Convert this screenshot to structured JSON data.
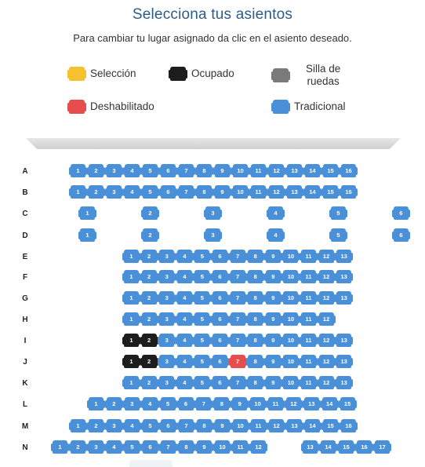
{
  "header": {
    "title": "Selecciona tus asientos",
    "subtitle": "Para cambiar tu lugar asignado da clic en el asiento deseado."
  },
  "legend": [
    {
      "key": "seleccion",
      "label": "Selección",
      "color": "#f5c12e"
    },
    {
      "key": "ocupado",
      "label": "Ocupado",
      "color": "#1d1d1d"
    },
    {
      "key": "silla",
      "label": "Silla de\nruedas",
      "color": "#7a7a7a"
    },
    {
      "key": "deshabilitado",
      "label": "Deshabilitado",
      "color": "#e84d4d"
    },
    {
      "key": "tradicional",
      "label": "Tradicional",
      "color": "#4a90d9"
    }
  ],
  "colors": {
    "tradicional": "#4a90d9",
    "ocupado": "#1d1d1d",
    "deshabilitado": "#e84d4d",
    "seleccion": "#f5c12e",
    "silla": "#7a7a7a"
  },
  "rows": [
    {
      "label": "A",
      "seats": [
        {
          "n": "1"
        },
        {
          "n": "2"
        },
        {
          "n": "3"
        },
        {
          "n": "4"
        },
        {
          "n": "5"
        },
        {
          "n": "6"
        },
        {
          "n": "7"
        },
        {
          "n": "8"
        },
        {
          "n": "9"
        },
        {
          "n": "10"
        },
        {
          "n": "11"
        },
        {
          "n": "12"
        },
        {
          "n": "13"
        },
        {
          "n": "14"
        },
        {
          "n": "15"
        },
        {
          "n": "16"
        }
      ]
    },
    {
      "label": "B",
      "seats": [
        {
          "n": "1"
        },
        {
          "n": "2"
        },
        {
          "n": "3"
        },
        {
          "n": "4"
        },
        {
          "n": "5"
        },
        {
          "n": "6"
        },
        {
          "n": "7"
        },
        {
          "n": "8"
        },
        {
          "n": "9"
        },
        {
          "n": "10"
        },
        {
          "n": "11"
        },
        {
          "n": "12"
        },
        {
          "n": "13"
        },
        {
          "n": "14"
        },
        {
          "n": "15"
        },
        {
          "n": "16"
        }
      ]
    },
    {
      "label": "C",
      "seats": [
        {
          "n": "1"
        },
        {
          "n": "2"
        },
        {
          "n": "3"
        },
        {
          "n": "4"
        },
        {
          "n": "5"
        },
        {
          "n": "6"
        }
      ]
    },
    {
      "label": "D",
      "seats": [
        {
          "n": "1"
        },
        {
          "n": "2"
        },
        {
          "n": "3"
        },
        {
          "n": "4"
        },
        {
          "n": "5"
        },
        {
          "n": "6"
        }
      ]
    },
    {
      "label": "E",
      "seats": [
        {
          "n": "1"
        },
        {
          "n": "2"
        },
        {
          "n": "3"
        },
        {
          "n": "4"
        },
        {
          "n": "5"
        },
        {
          "n": "6"
        },
        {
          "n": "7"
        },
        {
          "n": "8"
        },
        {
          "n": "9"
        },
        {
          "n": "10"
        },
        {
          "n": "11"
        },
        {
          "n": "12"
        },
        {
          "n": "13"
        }
      ]
    },
    {
      "label": "F",
      "seats": [
        {
          "n": "1"
        },
        {
          "n": "2"
        },
        {
          "n": "3"
        },
        {
          "n": "4"
        },
        {
          "n": "5"
        },
        {
          "n": "6"
        },
        {
          "n": "7"
        },
        {
          "n": "8"
        },
        {
          "n": "9"
        },
        {
          "n": "10"
        },
        {
          "n": "11"
        },
        {
          "n": "12"
        },
        {
          "n": "13"
        }
      ]
    },
    {
      "label": "G",
      "seats": [
        {
          "n": "1"
        },
        {
          "n": "2"
        },
        {
          "n": "3"
        },
        {
          "n": "4"
        },
        {
          "n": "5"
        },
        {
          "n": "6"
        },
        {
          "n": "7"
        },
        {
          "n": "8"
        },
        {
          "n": "9"
        },
        {
          "n": "10"
        },
        {
          "n": "11"
        },
        {
          "n": "12"
        },
        {
          "n": "13"
        }
      ]
    },
    {
      "label": "H",
      "seats": [
        {
          "n": "1"
        },
        {
          "n": "2"
        },
        {
          "n": "3"
        },
        {
          "n": "4"
        },
        {
          "n": "5"
        },
        {
          "n": "6"
        },
        {
          "n": "7"
        },
        {
          "n": "8"
        },
        {
          "n": "9"
        },
        {
          "n": "10"
        },
        {
          "n": "11"
        },
        {
          "n": "12"
        }
      ]
    },
    {
      "label": "I",
      "seats": [
        {
          "n": "1",
          "status": "ocupado"
        },
        {
          "n": "2",
          "status": "ocupado"
        },
        {
          "n": "3"
        },
        {
          "n": "4"
        },
        {
          "n": "5"
        },
        {
          "n": "6"
        },
        {
          "n": "7"
        },
        {
          "n": "8"
        },
        {
          "n": "9"
        },
        {
          "n": "10"
        },
        {
          "n": "11"
        },
        {
          "n": "12"
        },
        {
          "n": "13"
        }
      ]
    },
    {
      "label": "J",
      "seats": [
        {
          "n": "1",
          "status": "ocupado"
        },
        {
          "n": "2",
          "status": "ocupado"
        },
        {
          "n": "3"
        },
        {
          "n": "4"
        },
        {
          "n": "5"
        },
        {
          "n": "6"
        },
        {
          "n": "7",
          "status": "deshabilitado"
        },
        {
          "n": "8"
        },
        {
          "n": "9"
        },
        {
          "n": "10"
        },
        {
          "n": "11"
        },
        {
          "n": "12"
        },
        {
          "n": "13"
        }
      ]
    },
    {
      "label": "K",
      "seats": [
        {
          "n": "1"
        },
        {
          "n": "2"
        },
        {
          "n": "3"
        },
        {
          "n": "4"
        },
        {
          "n": "5"
        },
        {
          "n": "6"
        },
        {
          "n": "7"
        },
        {
          "n": "8"
        },
        {
          "n": "9"
        },
        {
          "n": "10"
        },
        {
          "n": "11"
        },
        {
          "n": "12"
        },
        {
          "n": "13"
        }
      ]
    },
    {
      "label": "L",
      "seats": [
        {
          "n": "1"
        },
        {
          "n": "2"
        },
        {
          "n": "3"
        },
        {
          "n": "4"
        },
        {
          "n": "5"
        },
        {
          "n": "6"
        },
        {
          "n": "7"
        },
        {
          "n": "8"
        },
        {
          "n": "9"
        },
        {
          "n": "10"
        },
        {
          "n": "11"
        },
        {
          "n": "12"
        },
        {
          "n": "13"
        },
        {
          "n": "14"
        },
        {
          "n": "15"
        }
      ]
    },
    {
      "label": "M",
      "seats": [
        {
          "n": "1"
        },
        {
          "n": "2"
        },
        {
          "n": "3"
        },
        {
          "n": "4"
        },
        {
          "n": "5"
        },
        {
          "n": "6"
        },
        {
          "n": "7"
        },
        {
          "n": "8"
        },
        {
          "n": "9"
        },
        {
          "n": "10"
        },
        {
          "n": "11"
        },
        {
          "n": "12"
        },
        {
          "n": "13"
        },
        {
          "n": "14"
        },
        {
          "n": "15"
        },
        {
          "n": "16"
        }
      ]
    },
    {
      "label": "N",
      "seats": [
        {
          "n": "1"
        },
        {
          "n": "2"
        },
        {
          "n": "3"
        },
        {
          "n": "4"
        },
        {
          "n": "5"
        },
        {
          "n": "6"
        },
        {
          "n": "7"
        },
        {
          "n": "8"
        },
        {
          "n": "9"
        },
        {
          "n": "10"
        },
        {
          "n": "11"
        },
        {
          "n": "12"
        },
        {
          "n": "13"
        },
        {
          "n": "14"
        },
        {
          "n": "15"
        },
        {
          "n": "16"
        },
        {
          "n": "17"
        }
      ]
    }
  ]
}
